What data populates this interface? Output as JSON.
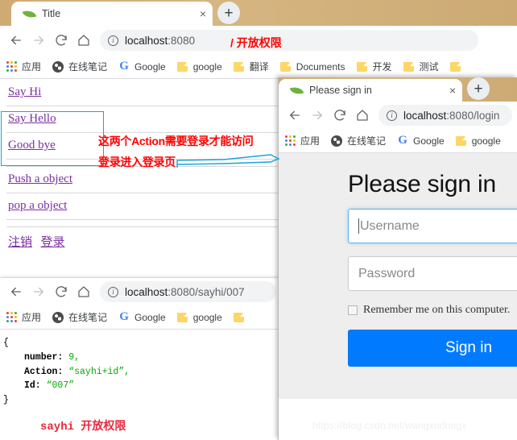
{
  "window1": {
    "tab": {
      "title": "Title",
      "close": "×",
      "favicon": "spring-leaf-icon"
    },
    "newtab_label": "+",
    "omnibox": {
      "url_main": "localhost",
      "url_port": ":8080"
    },
    "url_annotation": "/ 开放权限",
    "bookmarks": [
      {
        "label": "应用",
        "icon": "apps-grid-icon"
      },
      {
        "label": "在线笔记",
        "icon": "globe-icon"
      },
      {
        "label": "Google",
        "icon": "google-g-icon"
      },
      {
        "label": "google",
        "icon": "folder-icon"
      },
      {
        "label": "翻译",
        "icon": "folder-icon"
      },
      {
        "label": "Documents",
        "icon": "folder-icon"
      },
      {
        "label": "开发",
        "icon": "folder-icon"
      },
      {
        "label": "测试",
        "icon": "folder-icon"
      },
      {
        "label": "",
        "icon": "folder-icon"
      }
    ],
    "links": [
      "Say Hi",
      "Say Hello",
      "Good bye",
      "Push a object",
      "pop a object"
    ],
    "footer_links": [
      "注销",
      "登录"
    ]
  },
  "window2": {
    "tab": {
      "title": "Please sign in",
      "close": "×",
      "favicon": "spring-leaf-icon"
    },
    "newtab_label": "+",
    "omnibox": {
      "url_main": "localhost",
      "url_port": ":8080/login"
    },
    "bookmarks": [
      {
        "label": "应用",
        "icon": "apps-grid-icon"
      },
      {
        "label": "在线笔记",
        "icon": "globe-icon"
      },
      {
        "label": "Google",
        "icon": "google-g-icon"
      },
      {
        "label": "google",
        "icon": "folder-icon"
      }
    ],
    "page": {
      "heading": "Please sign in",
      "username_placeholder": "Username",
      "password_placeholder": "Password",
      "remember_label": "Remember me on this computer.",
      "signin_button": "Sign in"
    }
  },
  "window3": {
    "omnibox": {
      "url_main": "localhost",
      "url_port": ":8080/sayhi/007"
    },
    "bookmarks": [
      {
        "label": "应用",
        "icon": "apps-grid-icon"
      },
      {
        "label": "在线笔记",
        "icon": "globe-icon"
      },
      {
        "label": "Google",
        "icon": "google-g-icon"
      },
      {
        "label": "google",
        "icon": "folder-icon"
      },
      {
        "label": "",
        "icon": "folder-icon"
      }
    ],
    "json": {
      "open_brace": "{",
      "close_brace": "}",
      "rows": [
        {
          "key": "number:",
          "value": "9,",
          "kind": "num"
        },
        {
          "key": "Action:",
          "value": "“sayhi+id”,",
          "kind": "str"
        },
        {
          "key": "Id:",
          "value": "“007”",
          "kind": "str"
        }
      ]
    },
    "red_note": "sayhi 开放权限"
  },
  "annotations": {
    "line1": "这两个Action需要登录才能访问",
    "line2": "登录进入登录页",
    "box_color": "#1aa3d8",
    "text_color": "#ff0000"
  },
  "watermark": "https://blog.csdn.net/wangxudongx",
  "colors": {
    "tabstrip": "#d3b178",
    "link": "#7b2fa0",
    "signin_blue": "#007bff",
    "annotation_red": "#ff0000",
    "annotation_blue": "#1aa3d8"
  }
}
